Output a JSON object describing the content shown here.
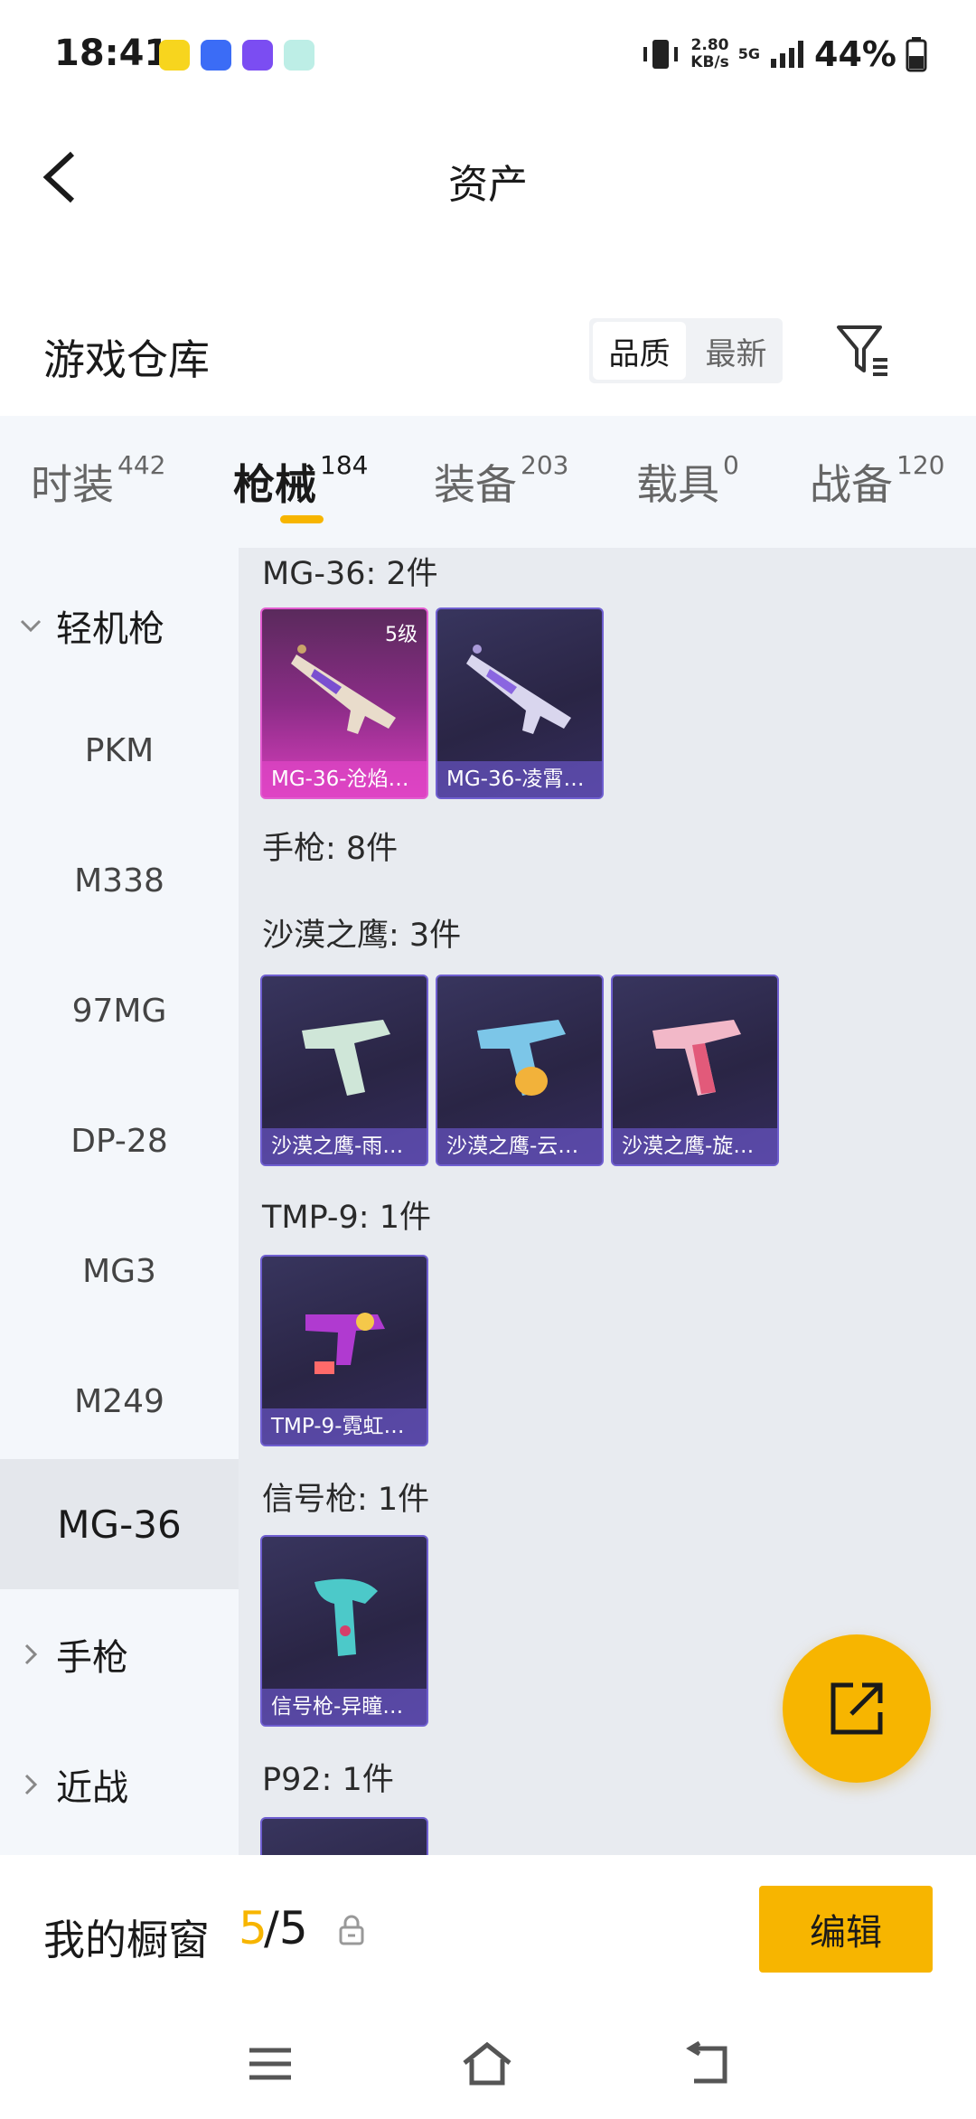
{
  "status_bar": {
    "time": "18:41",
    "net_speed_value": "2.80",
    "net_speed_unit": "KB/s",
    "network": "5G",
    "battery": "44%"
  },
  "header": {
    "title": "资产"
  },
  "warehouse": {
    "title": "游戏仓库",
    "sort_options": [
      "品质",
      "最新"
    ],
    "sort_selected": "品质"
  },
  "tabs": [
    {
      "label": "时装",
      "count": "442"
    },
    {
      "label": "枪械",
      "count": "184"
    },
    {
      "label": "装备",
      "count": "203"
    },
    {
      "label": "载具",
      "count": "0"
    },
    {
      "label": "战备",
      "count": "120"
    }
  ],
  "left_nav": {
    "group_lmg": "轻机枪",
    "items": [
      "PKM",
      "M338",
      "97MG",
      "DP-28",
      "MG3",
      "M249",
      "MG-36"
    ],
    "selected": "MG-36",
    "group_pistol": "手枪",
    "group_melee": "近战"
  },
  "sections": {
    "mg36": {
      "title": "MG-36: 2件",
      "cards": [
        {
          "label": "MG-36-沧焰…",
          "level": "5级"
        },
        {
          "label": "MG-36-凌霄…"
        }
      ]
    },
    "pistol": {
      "title": "手枪: 8件"
    },
    "deagle": {
      "title": "沙漠之鹰: 3件",
      "cards": [
        {
          "label": "沙漠之鹰-雨…"
        },
        {
          "label": "沙漠之鹰-云…"
        },
        {
          "label": "沙漠之鹰-旋…"
        }
      ]
    },
    "tmp9": {
      "title": "TMP-9: 1件",
      "cards": [
        {
          "label": "TMP-9-霓虹…"
        }
      ]
    },
    "flare": {
      "title": "信号枪: 1件",
      "cards": [
        {
          "label": "信号枪-异瞳…"
        }
      ]
    },
    "p92": {
      "title": "P92: 1件"
    }
  },
  "showcase": {
    "label": "我的橱窗",
    "current": "5",
    "total": "/5",
    "edit_label": "编辑"
  },
  "colors": {
    "accent": "#f7b500",
    "card_border": "#6f5fd0",
    "card_pink": "#d93fbd"
  }
}
